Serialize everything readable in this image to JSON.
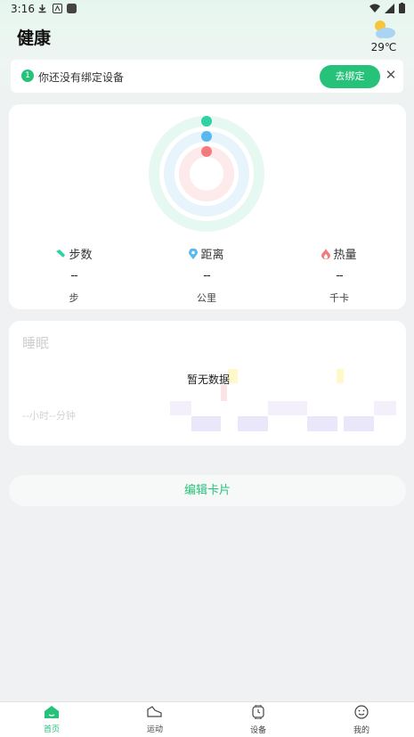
{
  "status_bar": {
    "time": "3:16"
  },
  "header": {
    "title": "健康"
  },
  "weather": {
    "temperature": "29℃",
    "icon": "partly-cloudy-icon"
  },
  "banner": {
    "badge": "1",
    "message": "你还没有绑定设备",
    "bind_button": "去绑定",
    "close_icon": "close-icon"
  },
  "activity": {
    "rings": [
      {
        "name": "steps",
        "color": "#2fd3a3"
      },
      {
        "name": "distance",
        "color": "#5ab8f0"
      },
      {
        "name": "calories",
        "color": "#f47b7b"
      }
    ],
    "metrics": [
      {
        "label": "步数",
        "value": "--",
        "unit": "步",
        "icon": "shoe-icon",
        "color": "#2fd3a3"
      },
      {
        "label": "距离",
        "value": "--",
        "unit": "公里",
        "icon": "location-pin-icon",
        "color": "#5ab8f0"
      },
      {
        "label": "热量",
        "value": "--",
        "unit": "千卡",
        "icon": "flame-icon",
        "color": "#f47b7b"
      }
    ]
  },
  "sleep": {
    "title": "睡眠",
    "no_data": "暂无数据",
    "duration": "--小时--分钟"
  },
  "edit_button": "编辑卡片",
  "tabs": [
    {
      "label": "首页",
      "icon": "home-icon",
      "active": true
    },
    {
      "label": "运动",
      "icon": "sneaker-icon",
      "active": false
    },
    {
      "label": "设备",
      "icon": "watch-icon",
      "active": false
    },
    {
      "label": "我的",
      "icon": "smiley-icon",
      "active": false
    }
  ],
  "colors": {
    "accent": "#27c27a"
  }
}
